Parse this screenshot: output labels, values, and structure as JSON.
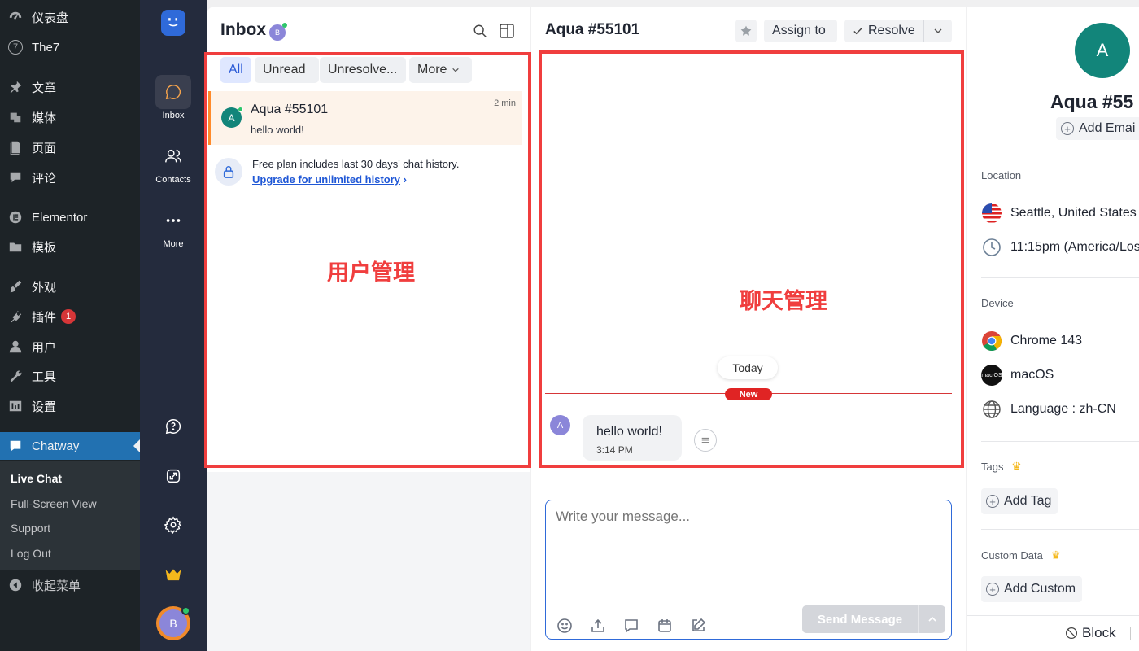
{
  "wp_menu": {
    "items": [
      {
        "label": "仪表盘",
        "icon": "dashboard-icon"
      },
      {
        "label": "The7",
        "icon": "the7-icon",
        "icon_text": "7"
      },
      {
        "label": "文章",
        "icon": "pin-icon"
      },
      {
        "label": "媒体",
        "icon": "media-icon"
      },
      {
        "label": "页面",
        "icon": "page-icon"
      },
      {
        "label": "评论",
        "icon": "comment-icon"
      },
      {
        "label": "Elementor",
        "icon": "elementor-icon"
      },
      {
        "label": "模板",
        "icon": "folder-icon"
      },
      {
        "label": "外观",
        "icon": "brush-icon"
      },
      {
        "label": "插件",
        "icon": "plugin-icon",
        "badge": "1"
      },
      {
        "label": "用户",
        "icon": "user-icon"
      },
      {
        "label": "工具",
        "icon": "wrench-icon"
      },
      {
        "label": "设置",
        "icon": "settings-icon"
      },
      {
        "label": "Chatway",
        "icon": "chatway-icon"
      }
    ],
    "submenu": [
      "Live Chat",
      "Full-Screen View",
      "Support",
      "Log Out"
    ],
    "collapse_label": "收起菜单"
  },
  "rail": {
    "inbox": "Inbox",
    "contacts": "Contacts",
    "more": "More",
    "user_initial": "B"
  },
  "list": {
    "title": "Inbox",
    "agent_initial": "B",
    "filters": [
      "All",
      "Unread",
      "Unresolve...",
      "More"
    ],
    "conversation": {
      "initial": "A",
      "name": "Aqua #55101",
      "time": "2 min",
      "preview": "hello world!"
    },
    "promo_text": "Free plan includes last 30 days' chat history.",
    "promo_link": "Upgrade for unlimited history",
    "annotation": "用户管理"
  },
  "chat": {
    "title": "Aqua #55101",
    "assign_label": "Assign to",
    "resolve_label": "Resolve",
    "annotation": "聊天管理",
    "today_label": "Today",
    "new_label": "New",
    "message": {
      "initial": "A",
      "text": "hello world!",
      "time": "3:14 PM"
    },
    "composer_placeholder": "Write your message...",
    "send_label": "Send Message"
  },
  "contact": {
    "initial": "A",
    "name": "Aqua #55",
    "add_email": "Add Emai",
    "location_title": "Location",
    "location": "Seattle, United States",
    "local_time": "11:15pm (America/Los",
    "device_title": "Device",
    "browser": "Chrome 143",
    "os": "macOS",
    "os_icon_text": "mac OS",
    "language": "Language : zh-CN",
    "tags_title": "Tags",
    "add_tag": "Add Tag",
    "custom_title": "Custom Data",
    "add_custom": "Add Custom",
    "block_label": "Block"
  },
  "colors": {
    "accent": "#2271b1",
    "chatway_accent": "#f4a24b",
    "annotation_red": "#f03e3e",
    "contact_avatar": "#12857a"
  }
}
